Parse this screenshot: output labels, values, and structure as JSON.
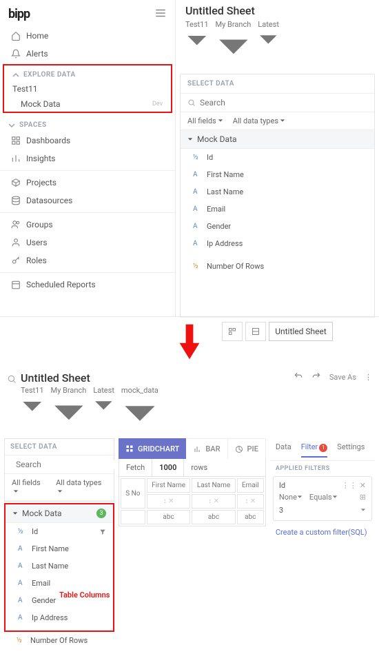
{
  "sidebar": {
    "logo": "bipp",
    "nav": {
      "home": "Home",
      "alerts": "Alerts"
    },
    "explore": {
      "header": "EXPLORE DATA",
      "project": "Test11",
      "datasource": "Mock Data",
      "dev": "Dev"
    },
    "spaces": {
      "header": "SPACES",
      "dashboards": "Dashboards",
      "insights": "Insights",
      "projects": "Projects",
      "datasources": "Datasources",
      "groups": "Groups",
      "users": "Users",
      "roles": "Roles",
      "scheduled": "Scheduled Reports"
    }
  },
  "sheet": {
    "title": "Untitled Sheet",
    "crumbs": {
      "project": "Test11",
      "branch": "My Branch",
      "tag": "Latest",
      "ds": "mock_data"
    }
  },
  "select_data": {
    "header": "SELECT DATA",
    "search_ph": "Search",
    "all_fields": "All fields",
    "all_types": "All data types",
    "table": "Mock Data",
    "cols": {
      "id": "Id",
      "first": "First Name",
      "last": "Last Name",
      "email": "Email",
      "gender": "Gender",
      "ip": "Ip Address"
    },
    "measure": "Number Of Rows",
    "count_badge": "3"
  },
  "sheet_tab": "Untitled Sheet",
  "annotation": "Table Columns",
  "top_actions": {
    "saveas": "Save As"
  },
  "viz": {
    "grid": "GRIDCHART",
    "bar": "BAR",
    "pie": "PIE"
  },
  "fetch": {
    "label": "Fetch",
    "value": "1000",
    "unit": "rows"
  },
  "grid": {
    "sno": "S No",
    "c1": "First Name",
    "c2": "Last Name",
    "c3": "Email",
    "abc": "abc"
  },
  "right": {
    "tabs": {
      "data": "Data",
      "filter": "Filter",
      "settings": "Settings",
      "badge": "1"
    },
    "applied": "APPLIED FILTERS",
    "field": "Id",
    "none": "None",
    "equals": "Equals",
    "val": "3",
    "custom": "Create a custom filter(SQL)"
  }
}
